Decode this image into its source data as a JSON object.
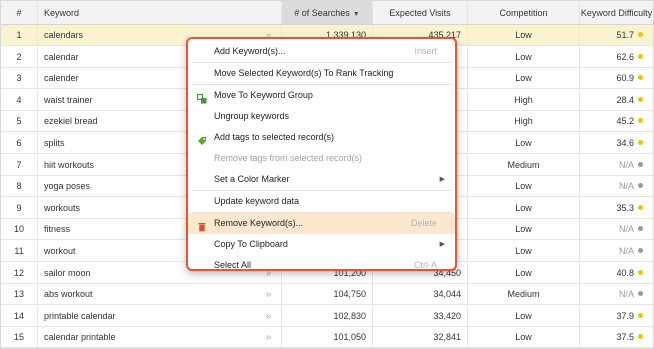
{
  "table": {
    "columns": [
      "#",
      "Keyword",
      "# of Searches",
      "Expected Visits",
      "Competition",
      "Keyword Difficulty"
    ],
    "sorted_column": "# of Searches",
    "arrow_glyph": "»",
    "rows": [
      {
        "n": "1",
        "keyword": "calendars",
        "searches": "1,339,130",
        "visits": "435,217",
        "competition": "Low",
        "difficulty": "51.7",
        "dot": "#f2c200",
        "selected": true
      },
      {
        "n": "2",
        "keyword": "calendar",
        "searches": "",
        "visits": "",
        "competition": "Low",
        "difficulty": "62.6",
        "dot": "#f2c200"
      },
      {
        "n": "3",
        "keyword": "calender",
        "searches": "",
        "visits": "",
        "competition": "Low",
        "difficulty": "60.9",
        "dot": "#f2c200"
      },
      {
        "n": "4",
        "keyword": "waist trainer",
        "searches": "",
        "visits": "",
        "competition": "High",
        "difficulty": "28.4",
        "dot": "#f2c200"
      },
      {
        "n": "5",
        "keyword": "ezekiel bread",
        "searches": "",
        "visits": "",
        "competition": "High",
        "difficulty": "45.2",
        "dot": "#f2c200"
      },
      {
        "n": "6",
        "keyword": "splits",
        "searches": "",
        "visits": "",
        "competition": "Low",
        "difficulty": "34.6",
        "dot": "#f2c200"
      },
      {
        "n": "7",
        "keyword": "hiit workouts",
        "searches": "",
        "visits": "",
        "competition": "Medium",
        "difficulty": "N/A",
        "dot": "#9a9a9a"
      },
      {
        "n": "8",
        "keyword": "yoga poses",
        "searches": "",
        "visits": "",
        "competition": "Low",
        "difficulty": "N/A",
        "dot": "#9a9a9a"
      },
      {
        "n": "9",
        "keyword": "workouts",
        "searches": "",
        "visits": "",
        "competition": "Low",
        "difficulty": "35.3",
        "dot": "#f2c200"
      },
      {
        "n": "10",
        "keyword": "fitness",
        "searches": "",
        "visits": "",
        "competition": "Low",
        "difficulty": "N/A",
        "dot": "#9a9a9a"
      },
      {
        "n": "11",
        "keyword": "workout",
        "searches": "",
        "visits": "",
        "competition": "Low",
        "difficulty": "N/A",
        "dot": "#9a9a9a"
      },
      {
        "n": "12",
        "keyword": "sailor moon",
        "searches": "101,200",
        "visits": "34,450",
        "competition": "Low",
        "difficulty": "40.8",
        "dot": "#f2c200"
      },
      {
        "n": "13",
        "keyword": "abs workout",
        "searches": "104,750",
        "visits": "34,044",
        "competition": "Medium",
        "difficulty": "N/A",
        "dot": "#9a9a9a"
      },
      {
        "n": "14",
        "keyword": "printable calendar",
        "searches": "102,830",
        "visits": "33,420",
        "competition": "Low",
        "difficulty": "37.9",
        "dot": "#f2c200"
      },
      {
        "n": "15",
        "keyword": "calendar printable",
        "searches": "101,050",
        "visits": "32,841",
        "competition": "Low",
        "difficulty": "37.5",
        "dot": "#f2c200"
      }
    ]
  },
  "context_menu": {
    "items": [
      {
        "label": "Add Keyword(s)...",
        "shortcut": "Insert",
        "icon": null,
        "disabled": false,
        "submenu": false,
        "sep_after": true
      },
      {
        "label": "Move Selected Keyword(s) To Rank Tracking",
        "shortcut": "",
        "icon": null,
        "disabled": false,
        "submenu": false,
        "sep_after": true
      },
      {
        "label": "Move To Keyword Group",
        "shortcut": "",
        "icon": "group-icon",
        "disabled": false,
        "submenu": false,
        "sep_after": false
      },
      {
        "label": "Ungroup keywords",
        "shortcut": "",
        "icon": null,
        "disabled": false,
        "submenu": false,
        "sep_after": false
      },
      {
        "label": "Add tags to selected record(s)",
        "shortcut": "",
        "icon": "tag-icon",
        "disabled": false,
        "submenu": false,
        "sep_after": false
      },
      {
        "label": "Remove tags from selected record(s)",
        "shortcut": "",
        "icon": null,
        "disabled": true,
        "submenu": false,
        "sep_after": false
      },
      {
        "label": "Set a Color Marker",
        "shortcut": "",
        "icon": null,
        "disabled": false,
        "submenu": true,
        "sep_after": true
      },
      {
        "label": "Update keyword data",
        "shortcut": "",
        "icon": null,
        "disabled": false,
        "submenu": false,
        "sep_after": true
      },
      {
        "label": "Remove Keyword(s)...",
        "shortcut": "Delete",
        "icon": "trash-icon",
        "disabled": false,
        "submenu": false,
        "sep_after": false,
        "highlighted": true
      },
      {
        "label": "Copy To Clipboard",
        "shortcut": "",
        "icon": null,
        "disabled": false,
        "submenu": true,
        "sep_after": false
      },
      {
        "label": "Select All",
        "shortcut": "Ctrl-A",
        "icon": null,
        "disabled": false,
        "submenu": false,
        "sep_after": false
      }
    ]
  },
  "colors": {
    "menu_border": "#e4572e",
    "selected_row": "#fbf3d0",
    "menu_highlight": "#fbe8cf",
    "difficulty_dot": "#f2c200",
    "na_dot": "#9a9a9a",
    "group_icon": "#3c9a2e",
    "tag_icon": "#5aa832",
    "trash_icon": "#d4532a"
  }
}
